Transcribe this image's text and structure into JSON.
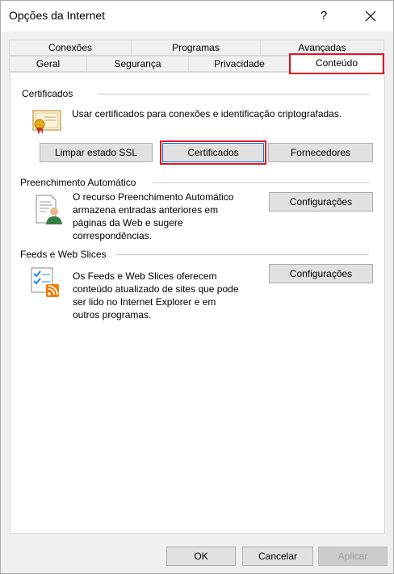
{
  "window": {
    "title": "Opções da Internet",
    "help_label": "?"
  },
  "tabs": {
    "row1": [
      {
        "label": "Conexões"
      },
      {
        "label": "Programas"
      },
      {
        "label": "Avançadas"
      }
    ],
    "row2": [
      {
        "label": "Geral"
      },
      {
        "label": "Segurança"
      },
      {
        "label": "Privacidade"
      },
      {
        "label": "Conteúdo",
        "selected": true
      }
    ]
  },
  "certificates": {
    "heading": "Certificados",
    "description": "Usar certificados para conexões e identificação criptografadas.",
    "buttons": {
      "clear_ssl": "Limpar estado SSL",
      "certificates": "Certificados",
      "publishers": "Fornecedores"
    }
  },
  "autocomplete": {
    "heading": "Preenchimento Automático",
    "description_lines": [
      "O recurso Preenchimento Automático",
      "armazena entradas anteriores em",
      "páginas da Web e sugere",
      "correspondências."
    ],
    "settings_button": "Configurações"
  },
  "feeds": {
    "heading": "Feeds e Web Slices",
    "description_lines": [
      "Os Feeds e Web Slices oferecem",
      "conteúdo atualizado de sites que pode",
      "ser lido no Internet Explorer e em",
      "outros programas."
    ],
    "settings_button": "Configurações"
  },
  "footer": {
    "ok": "OK",
    "cancel": "Cancelar",
    "apply": "Aplicar"
  },
  "colors": {
    "highlight": "#e81123",
    "focus_border": "#0078d7"
  },
  "icons": {
    "certificate": "certificate-icon",
    "autocomplete": "autocomplete-user-document-icon",
    "feeds": "rss-feed-checklist-icon",
    "close": "close-icon"
  }
}
